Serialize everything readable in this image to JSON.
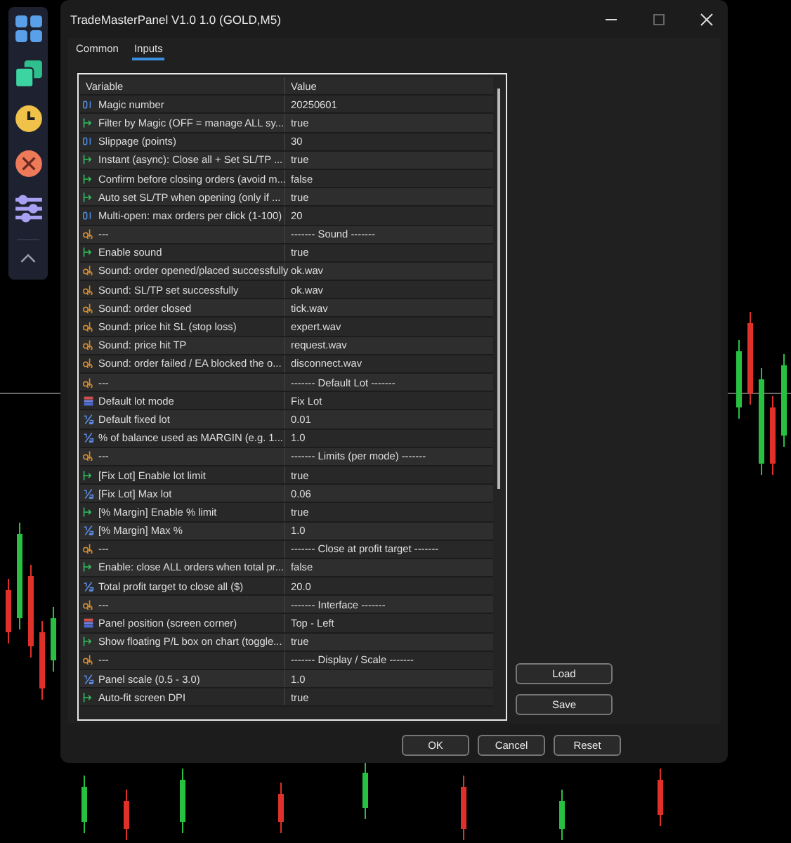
{
  "window": {
    "title": "TradeMasterPanel V1.0 1.0 (GOLD,M5)"
  },
  "tabs": [
    {
      "label": "Common",
      "selected": false
    },
    {
      "label": "Inputs",
      "selected": true
    }
  ],
  "table": {
    "columns": [
      "Variable",
      "Value"
    ],
    "rows": [
      {
        "kind": "int",
        "variable": "Magic number",
        "value": "20250601"
      },
      {
        "kind": "bool",
        "variable": "Filter by Magic (OFF = manage ALL sy...",
        "value": "true"
      },
      {
        "kind": "int",
        "variable": "Slippage (points)",
        "value": "30"
      },
      {
        "kind": "bool",
        "variable": "Instant (async): Close all + Set SL/TP ...",
        "value": "true"
      },
      {
        "kind": "bool",
        "variable": "Confirm before closing orders (avoid m...",
        "value": "false"
      },
      {
        "kind": "bool",
        "variable": "Auto set SL/TP when opening (only if ...",
        "value": "true"
      },
      {
        "kind": "int",
        "variable": "Multi-open: max orders per click (1-100)",
        "value": "20"
      },
      {
        "kind": "string",
        "variable": "---",
        "value": "------- Sound -------"
      },
      {
        "kind": "bool",
        "variable": "Enable sound",
        "value": "true"
      },
      {
        "kind": "string",
        "variable": "Sound: order opened/placed successfully",
        "value": "ok.wav"
      },
      {
        "kind": "string",
        "variable": "Sound: SL/TP set successfully",
        "value": "ok.wav"
      },
      {
        "kind": "string",
        "variable": "Sound: order closed",
        "value": "tick.wav"
      },
      {
        "kind": "string",
        "variable": "Sound: price hit SL (stop loss)",
        "value": "expert.wav"
      },
      {
        "kind": "string",
        "variable": "Sound: price hit TP",
        "value": "request.wav"
      },
      {
        "kind": "string",
        "variable": "Sound: order failed / EA blocked the o...",
        "value": "disconnect.wav"
      },
      {
        "kind": "string",
        "variable": "---",
        "value": "------- Default Lot -------"
      },
      {
        "kind": "enum",
        "variable": "Default lot mode",
        "value": "Fix Lot"
      },
      {
        "kind": "double",
        "variable": "Default fixed lot",
        "value": "0.01"
      },
      {
        "kind": "double",
        "variable": "% of balance used as MARGIN (e.g. 1...",
        "value": "1.0"
      },
      {
        "kind": "string",
        "variable": "---",
        "value": "------- Limits (per mode) -------"
      },
      {
        "kind": "bool",
        "variable": "[Fix Lot] Enable lot limit",
        "value": "true"
      },
      {
        "kind": "double",
        "variable": "[Fix Lot] Max lot",
        "value": "0.06"
      },
      {
        "kind": "bool",
        "variable": "[% Margin] Enable % limit",
        "value": "true"
      },
      {
        "kind": "double",
        "variable": "[% Margin] Max %",
        "value": "1.0"
      },
      {
        "kind": "string",
        "variable": "---",
        "value": "------- Close at profit target -------"
      },
      {
        "kind": "bool",
        "variable": "Enable: close ALL orders when total pr...",
        "value": "false"
      },
      {
        "kind": "double",
        "variable": "Total profit target to close all ($)",
        "value": "20.0"
      },
      {
        "kind": "string",
        "variable": "---",
        "value": "------- Interface -------"
      },
      {
        "kind": "enum",
        "variable": "Panel position (screen corner)",
        "value": "Top - Left"
      },
      {
        "kind": "bool",
        "variable": "Show floating P/L box on chart (toggle...",
        "value": "true"
      },
      {
        "kind": "string",
        "variable": "---",
        "value": "------- Display / Scale -------"
      },
      {
        "kind": "double",
        "variable": "Panel scale (0.5 - 3.0)",
        "value": "1.0"
      },
      {
        "kind": "bool",
        "variable": "Auto-fit screen DPI",
        "value": "true"
      }
    ]
  },
  "side_buttons": [
    "Load",
    "Save"
  ],
  "buttons": [
    "OK",
    "Cancel",
    "Reset"
  ]
}
